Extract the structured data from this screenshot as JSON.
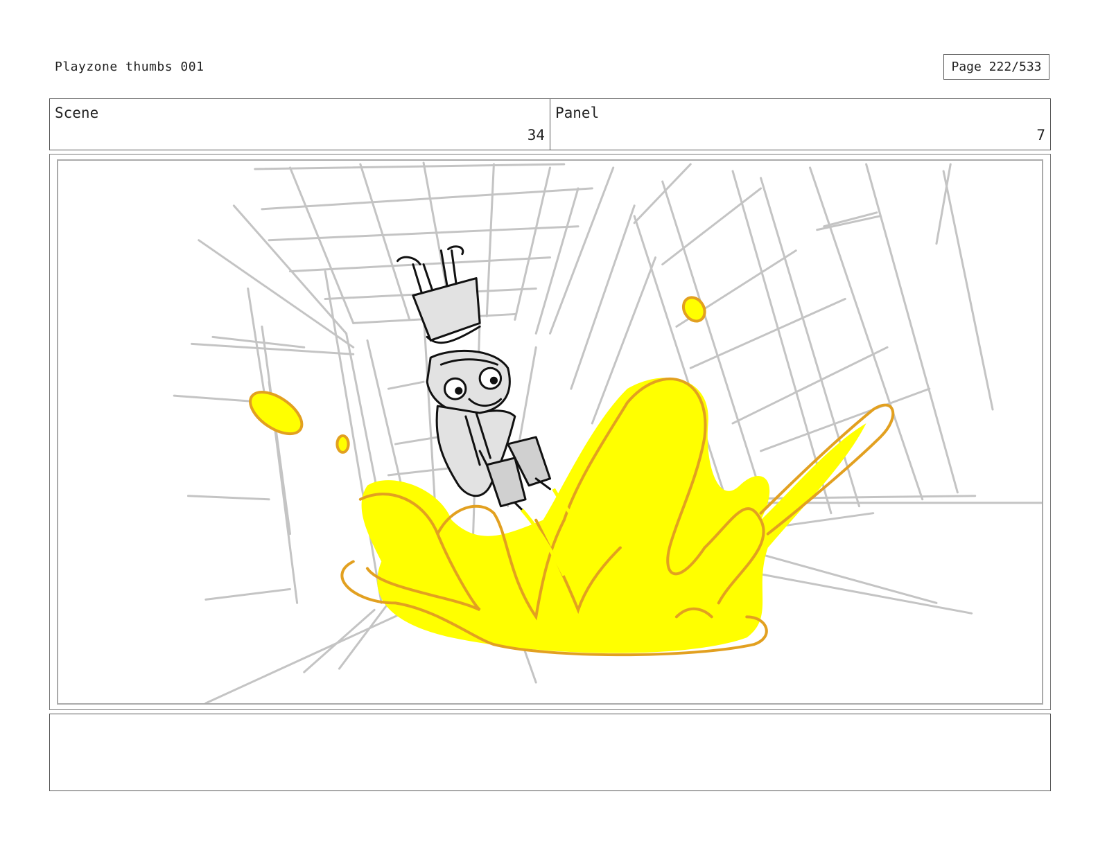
{
  "header": {
    "title": "Playzone thumbs 001",
    "page": "Page 222/533"
  },
  "info": {
    "scene_label": "Scene",
    "scene_value": "34",
    "panel_label": "Panel",
    "panel_value": "7"
  },
  "artwork": {
    "description_icon": "storyboard-sketch",
    "colors": {
      "sketch": "#c4c4c4",
      "ink": "#111111",
      "splash_fill": "#ffff00",
      "splash_outline": "#e2a020"
    }
  },
  "notes": {
    "text": ""
  }
}
